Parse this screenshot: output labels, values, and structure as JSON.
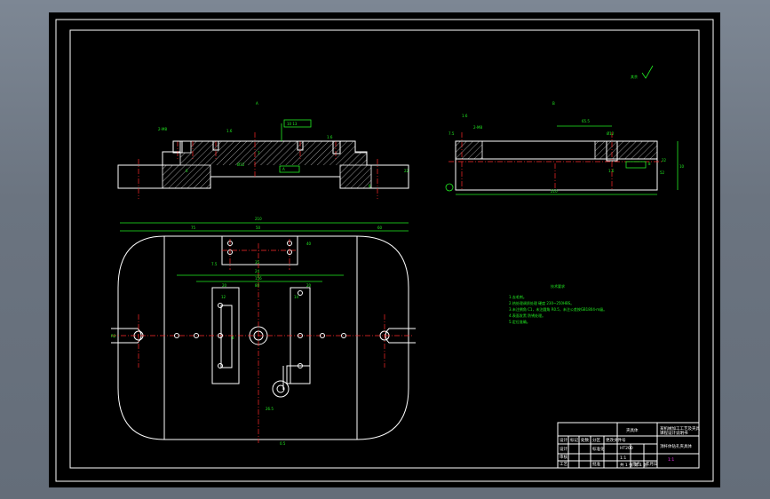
{
  "colors": {
    "background_gradient": "#6b7480",
    "canvas": "#000000",
    "frame": "#ffffff",
    "geometry": "#ffffff",
    "dimension": "#22ee22",
    "centerline": "#ff2a2a",
    "accent": "#ff33ff"
  },
  "views": {
    "section_a_label": "A",
    "section_b_label": "B",
    "roughness_note": "其余",
    "left_section": {
      "dims": [
        "2-M8",
        "1.6",
        "10 13",
        "6",
        "A",
        "Ø12",
        "22",
        "8",
        "1.6",
        "7"
      ]
    },
    "right_section": {
      "dims": [
        "7.5",
        "2-M8",
        "1.6",
        "65.5",
        "Ø12",
        "1.6",
        "8",
        "22",
        "210",
        "52",
        "10"
      ]
    },
    "plan_view": {
      "dims": [
        "210",
        "75",
        "50",
        "60",
        "40",
        "7.5",
        "35",
        "24",
        "156",
        "20",
        "80",
        "20",
        "12",
        "14",
        "8",
        "26.5",
        "R2",
        "0.5"
      ]
    }
  },
  "notes": {
    "title": "技术要求",
    "lines": [
      "1.去毛刺。",
      "2.热处理调质处理 硬度 230~250HBS。",
      "3.未注倒角 C1，未注圆角 R0.5，未注公差按GB1804-m级。",
      "4.表面发黑 防锈处理。",
      "5.定位准确。"
    ]
  },
  "title_block": {
    "drawing_name": "夹具体",
    "designer_label": "设计",
    "company_line1": "某机械加工工艺及夹具",
    "company_line2": "课程设计说明书",
    "part_name": "顶杆体钻孔夹具体",
    "material": "HT200",
    "scale": "1:1",
    "sheet": "共 1 张 第 1 张",
    "row_labels": [
      "标记",
      "处数",
      "分区",
      "更改文件号",
      "签名",
      "年月日"
    ],
    "row2": [
      "设计",
      "",
      "",
      "标准化",
      "",
      ""
    ],
    "row3": [
      "审核",
      "",
      "",
      "",
      "",
      ""
    ],
    "row4": [
      "工艺",
      "",
      "",
      "批准",
      "",
      ""
    ],
    "stamp": "1:1"
  }
}
